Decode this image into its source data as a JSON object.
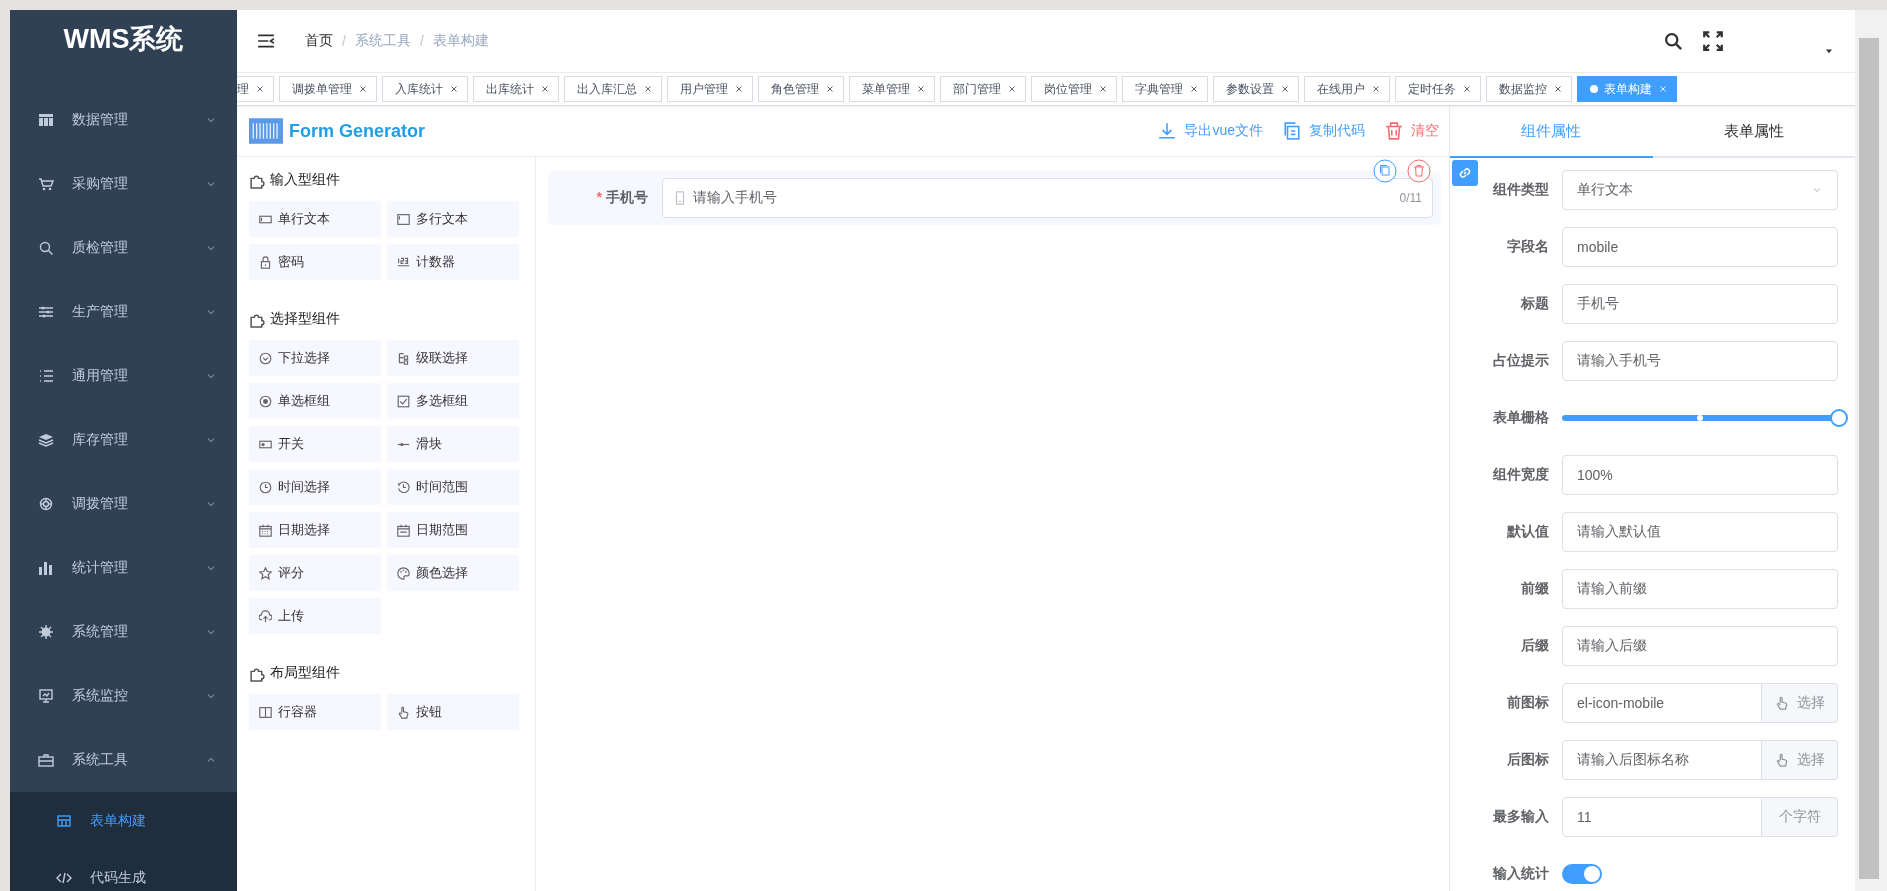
{
  "sidebar": {
    "title": "WMS系统",
    "items": [
      {
        "label": "数据管理",
        "expanded": false
      },
      {
        "label": "采购管理",
        "expanded": false
      },
      {
        "label": "质检管理",
        "expanded": false
      },
      {
        "label": "生产管理",
        "expanded": false
      },
      {
        "label": "通用管理",
        "expanded": false
      },
      {
        "label": "库存管理",
        "expanded": false
      },
      {
        "label": "调拨管理",
        "expanded": false
      },
      {
        "label": "统计管理",
        "expanded": false
      },
      {
        "label": "系统管理",
        "expanded": false
      },
      {
        "label": "系统监控",
        "expanded": false
      },
      {
        "label": "系统工具",
        "expanded": true,
        "children": [
          {
            "label": "表单构建",
            "selected": true
          },
          {
            "label": "代码生成",
            "selected": false
          }
        ]
      }
    ]
  },
  "header": {
    "breadcrumb": {
      "separator": "/",
      "items": [
        "首页",
        "系统工具",
        "表单构建"
      ]
    }
  },
  "tabs": [
    {
      "label": "理",
      "selected": false
    },
    {
      "label": "调拨单管理",
      "selected": false
    },
    {
      "label": "入库统计",
      "selected": false
    },
    {
      "label": "出库统计",
      "selected": false
    },
    {
      "label": "出入库汇总",
      "selected": false
    },
    {
      "label": "用户管理",
      "selected": false
    },
    {
      "label": "角色管理",
      "selected": false
    },
    {
      "label": "菜单管理",
      "selected": false
    },
    {
      "label": "部门管理",
      "selected": false
    },
    {
      "label": "岗位管理",
      "selected": false
    },
    {
      "label": "字典管理",
      "selected": false
    },
    {
      "label": "参数设置",
      "selected": false
    },
    {
      "label": "在线用户",
      "selected": false
    },
    {
      "label": "定时任务",
      "selected": false
    },
    {
      "label": "数据监控",
      "selected": false
    },
    {
      "label": "表单构建",
      "selected": true
    }
  ],
  "generator": {
    "title": "Form Generator",
    "actions": [
      {
        "kind": "download",
        "label": "导出vue文件"
      },
      {
        "kind": "copy",
        "label": "复制代码"
      },
      {
        "kind": "clear",
        "label": "清空"
      }
    ],
    "groups": [
      {
        "title": "输入型组件",
        "items": [
          "单行文本",
          "多行文本",
          "密码",
          "计数器"
        ]
      },
      {
        "title": "选择型组件",
        "items": [
          "下拉选择",
          "级联选择",
          "单选框组",
          "多选框组",
          "开关",
          "滑块",
          "时间选择",
          "时间范围",
          "日期选择",
          "日期范围",
          "评分",
          "颜色选择",
          "上传"
        ]
      },
      {
        "title": "布局型组件",
        "items": [
          "行容器",
          "按钮"
        ]
      }
    ]
  },
  "canvas": {
    "fields": [
      {
        "label": "手机号",
        "required_mark": "*",
        "placeholder": "请输入手机号",
        "counter": "0/11"
      }
    ]
  },
  "properties": {
    "tabs": [
      {
        "label": "组件属性",
        "selected": true
      },
      {
        "label": "表单属性",
        "selected": false
      }
    ],
    "rows": [
      {
        "kind": "select",
        "label": "组件类型",
        "value": "单行文本"
      },
      {
        "kind": "input",
        "label": "字段名",
        "value": "mobile"
      },
      {
        "kind": "input",
        "label": "标题",
        "value": "手机号"
      },
      {
        "kind": "input",
        "label": "占位提示",
        "value": "请输入手机号"
      },
      {
        "kind": "slider",
        "label": "表单栅格",
        "level": 1
      },
      {
        "kind": "input",
        "label": "组件宽度",
        "value": "100%"
      },
      {
        "kind": "input",
        "label": "默认值",
        "placeholder": "请输入默认值"
      },
      {
        "kind": "input",
        "label": "前缀",
        "placeholder": "请输入前缀"
      },
      {
        "kind": "input",
        "label": "后缀",
        "placeholder": "请输入后缀"
      },
      {
        "kind": "input",
        "label": "前图标",
        "value": "el-icon-mobile",
        "append": {
          "kind": "button",
          "label": "选择"
        }
      },
      {
        "kind": "input",
        "label": "后图标",
        "placeholder": "请输入后图标名称",
        "append": {
          "kind": "button",
          "label": "选择"
        }
      },
      {
        "kind": "input",
        "label": "最多输入",
        "value": "11",
        "append": {
          "kind": "text",
          "label": "个字符"
        }
      },
      {
        "kind": "switch",
        "label": "输入统计",
        "on": true
      }
    ]
  }
}
